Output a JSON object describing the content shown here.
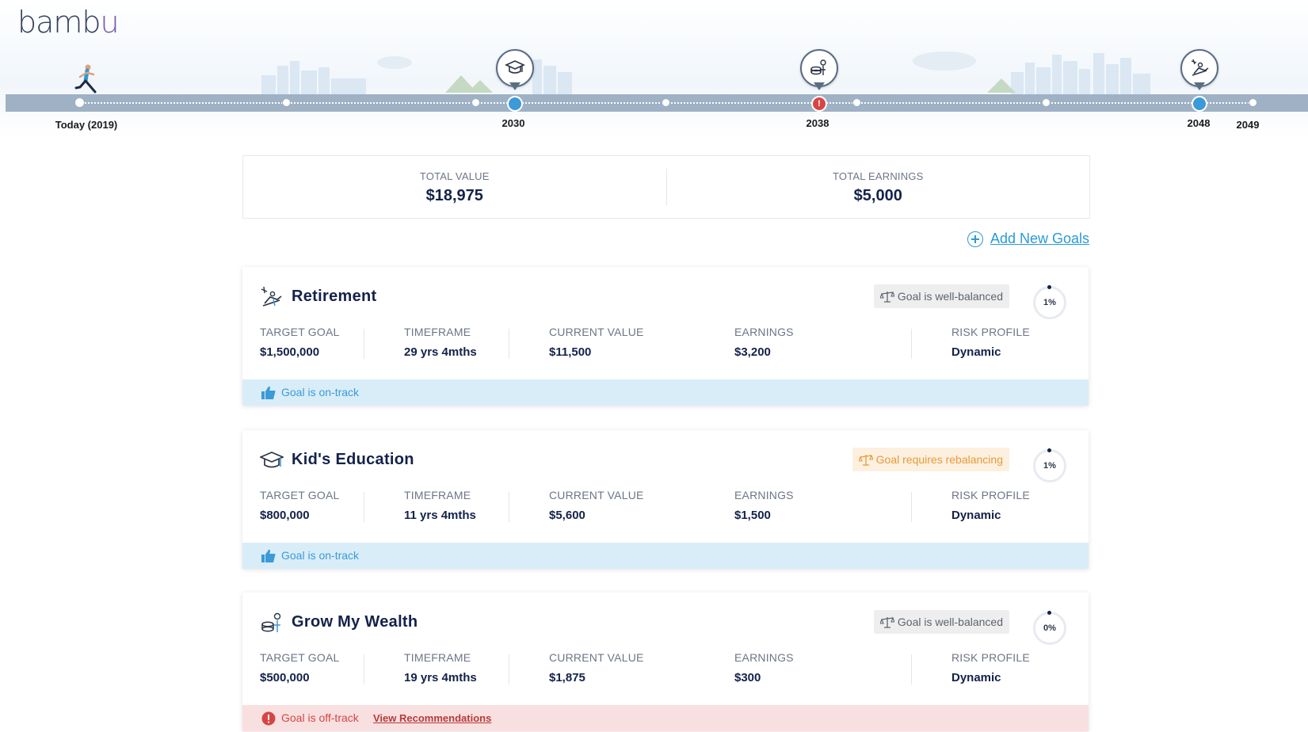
{
  "app": {
    "logo_main": "bamb",
    "logo_accent": "u"
  },
  "timeline": {
    "labels": [
      {
        "text": "Today (2019)"
      },
      {
        "text": "2030"
      },
      {
        "text": "2038"
      },
      {
        "text": "2048"
      },
      {
        "text": "2049"
      }
    ],
    "milestones": [
      {
        "year": "2030",
        "icon": "graduation-cap-icon",
        "status": "on-track"
      },
      {
        "year": "2038",
        "icon": "coins-growth-icon",
        "status": "off-track"
      },
      {
        "year": "2048",
        "icon": "beach-chair-icon",
        "status": "on-track"
      }
    ]
  },
  "summary": {
    "total_value_label": "TOTAL VALUE",
    "total_value": "$18,975",
    "total_earnings_label": "TOTAL EARNINGS",
    "total_earnings": "$5,000"
  },
  "actions": {
    "add_goals": "Add New Goals"
  },
  "stat_labels": {
    "target": "TARGET GOAL",
    "timeframe": "TIMEFRAME",
    "current": "CURRENT VALUE",
    "earnings": "EARNINGS",
    "risk": "RISK PROFILE"
  },
  "goals": [
    {
      "title": "Retirement",
      "icon": "beach-chair-icon",
      "badge": "Goal is well-balanced",
      "progress": "1%",
      "target": "$1,500,000",
      "timeframe": "29 yrs 4mths",
      "current": "$11,500",
      "earnings": "$3,200",
      "risk": "Dynamic",
      "status": "Goal is on-track"
    },
    {
      "title": "Kid's Education",
      "icon": "graduation-cap-icon",
      "badge": "Goal requires rebalancing",
      "progress": "1%",
      "target": "$800,000",
      "timeframe": "11 yrs 4mths",
      "current": "$5,600",
      "earnings": "$1,500",
      "risk": "Dynamic",
      "status": "Goal is on-track"
    },
    {
      "title": "Grow My Wealth",
      "icon": "coins-growth-icon",
      "badge": "Goal is well-balanced",
      "progress": "0%",
      "target": "$500,000",
      "timeframe": "19 yrs 4mths",
      "current": "$1,875",
      "earnings": "$300",
      "risk": "Dynamic",
      "status": "Goal is off-track",
      "status_link": "View Recommendations"
    }
  ],
  "colors": {
    "primary": "#14224a",
    "accent": "#2b9ad7",
    "on_track_bg": "#d9edf8",
    "off_track_bg": "#f9e0e0",
    "warning": "#e69a3a",
    "alert": "#d64545"
  }
}
